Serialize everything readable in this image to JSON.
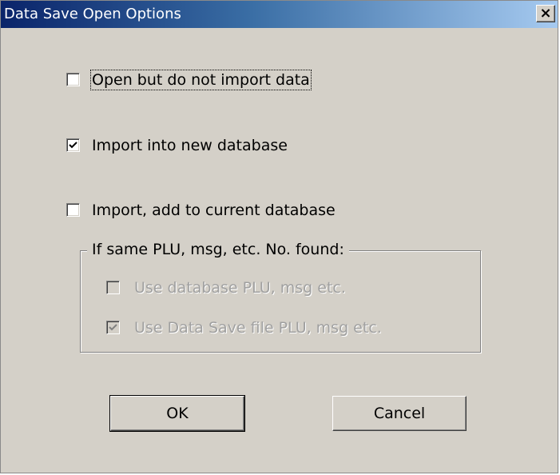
{
  "window": {
    "title": "Data Save Open Options",
    "close_glyph": "×"
  },
  "options": [
    {
      "label": "Open but do not import data",
      "checked": false,
      "enabled": true
    },
    {
      "label": "Import into new database",
      "checked": true,
      "enabled": true
    },
    {
      "label": "Import, add to current database",
      "checked": false,
      "enabled": true
    }
  ],
  "group": {
    "legend": "If same PLU, msg, etc. No. found:",
    "options": [
      {
        "label": "Use database PLU, msg etc.",
        "checked": false,
        "enabled": false
      },
      {
        "label": "Use Data Save file PLU, msg etc.",
        "checked": true,
        "enabled": false
      }
    ]
  },
  "buttons": {
    "ok_label": "OK",
    "cancel_label": "Cancel"
  },
  "colors": {
    "titlebar_start": "#0a246a",
    "titlebar_end": "#a6caf0",
    "dialog_face": "#d4d0c8",
    "disabled_text": "#a0a0a0"
  },
  "icons": {
    "checked": "checkmark-icon",
    "close": "close-icon"
  }
}
